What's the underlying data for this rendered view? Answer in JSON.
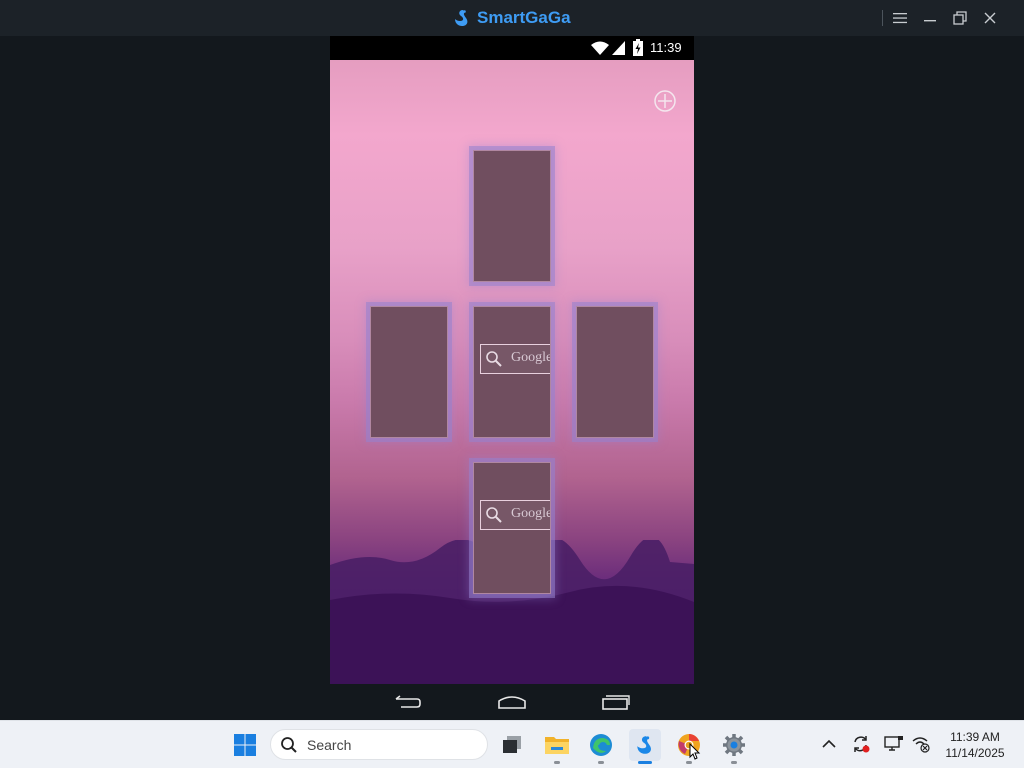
{
  "window": {
    "app_title": "SmartGaGa",
    "icons": [
      "swan-logo-icon",
      "hamburger-menu-icon",
      "minimize-icon",
      "restore-icon",
      "close-icon"
    ]
  },
  "android": {
    "status_time": "11:39",
    "status_icons": [
      "wifi-icon",
      "cell-signal-icon",
      "battery-charging-icon"
    ],
    "add_page_icon": "plus-circle-icon",
    "page_thumbnails": [
      {
        "position": "top",
        "widget": null
      },
      {
        "position": "left",
        "widget": null
      },
      {
        "position": "center",
        "widget": "Google"
      },
      {
        "position": "right",
        "widget": null
      },
      {
        "position": "bottom",
        "widget": "Google"
      }
    ],
    "nav_buttons": [
      "back-icon",
      "home-icon",
      "recents-icon"
    ]
  },
  "taskbar": {
    "search_label": "Search",
    "pinned": [
      "windows-start-icon",
      "task-view-icon",
      "file-explorer-icon",
      "edge-icon",
      "smartgaga-icon",
      "chrome-canary-icon",
      "settings-icon"
    ],
    "tray_icons": [
      "chevron-up-icon",
      "sync-icon",
      "display-icon",
      "network-icon"
    ],
    "clock_time": "11:39 AM",
    "clock_date": "11/14/2025"
  },
  "colors": {
    "accent": "#3e9cf4",
    "titlebar": "#1c2228",
    "desktop": "#13181d",
    "taskbar": "#eef1f6",
    "thumbnail_fill": "#704e5f",
    "thumbnail_glow": "#9682cd"
  }
}
